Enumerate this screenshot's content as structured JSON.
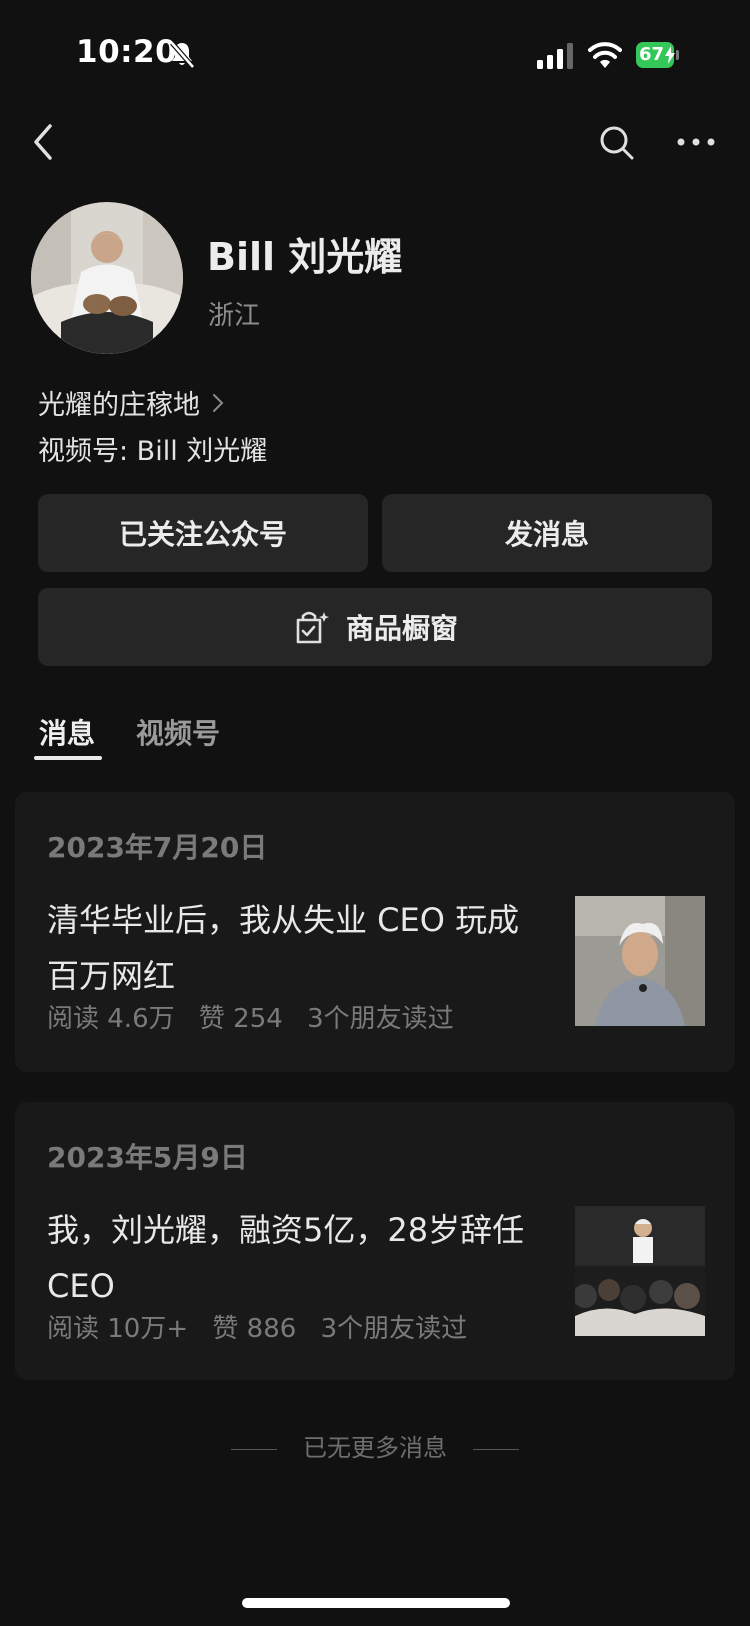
{
  "status_bar": {
    "time": "10:20",
    "battery": "67",
    "icons": [
      "bell-slash-icon",
      "signal-icon",
      "wifi-icon",
      "battery-icon"
    ]
  },
  "nav": {
    "back_icon": "chevron-left-icon",
    "search_icon": "search-icon",
    "more_icon": "more-icon"
  },
  "profile": {
    "name": "Bill 刘光耀",
    "location": "浙江",
    "linked_account": "光耀的庄稼地",
    "channel": "视频号: Bill 刘光耀"
  },
  "buttons": {
    "follow": "已关注公众号",
    "message": "发消息",
    "shop": "商品橱窗"
  },
  "tabs": [
    {
      "label": "消息",
      "active": true
    },
    {
      "label": "视频号",
      "active": false
    }
  ],
  "articles": [
    {
      "date": "2023年7月20日",
      "title": "清华毕业后，我从失业 CEO 玩成百万网红",
      "reads": "阅读 4.6万",
      "likes": "赞 254",
      "friends": "3个朋友读过"
    },
    {
      "date": "2023年5月9日",
      "title": "我，刘光耀，融资5亿，28岁辞任 CEO",
      "reads": "阅读 10万+",
      "likes": "赞 886",
      "friends": "3个朋友读过"
    }
  ],
  "footer": {
    "end_text": "已无更多消息"
  },
  "colors": {
    "background": "#111111",
    "card": "#191919",
    "button": "#262626",
    "battery": "#34c759"
  }
}
